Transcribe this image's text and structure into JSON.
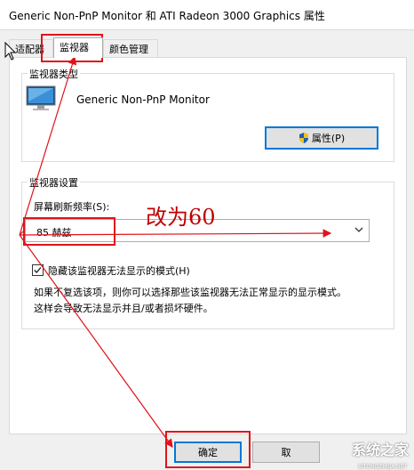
{
  "window": {
    "title": "Generic Non-PnP Monitor 和 ATI Radeon 3000 Graphics 属性"
  },
  "tabs": [
    {
      "label": "适配器",
      "active": false
    },
    {
      "label": "监视器",
      "active": true
    },
    {
      "label": "颜色管理",
      "active": false
    }
  ],
  "monitor_type": {
    "group_label": "监视器类型",
    "monitor_name": "Generic Non-PnP Monitor",
    "properties_button": "属性(P)",
    "icon": "monitor-icon"
  },
  "monitor_settings": {
    "group_label": "监视器设置",
    "refresh_label": "屏幕刷新频率(S):",
    "refresh_value": "85 赫兹",
    "hide_modes_checked": true,
    "hide_modes_label": "隐藏该监视器无法显示的模式(H)",
    "help_line1": "如果不复选该项，则你可以选择那些该监视器无法正常显示的显示模式。",
    "help_line2": "这样会导致无法显示并且/或者损坏硬件。"
  },
  "footer": {
    "ok_button": "确定",
    "cancel_button": "取"
  },
  "annotation": {
    "text": "改为60",
    "color": "#e0131a"
  },
  "watermark": {
    "text": "系统之家",
    "sub": "XITONGZHIJIA.NET"
  }
}
